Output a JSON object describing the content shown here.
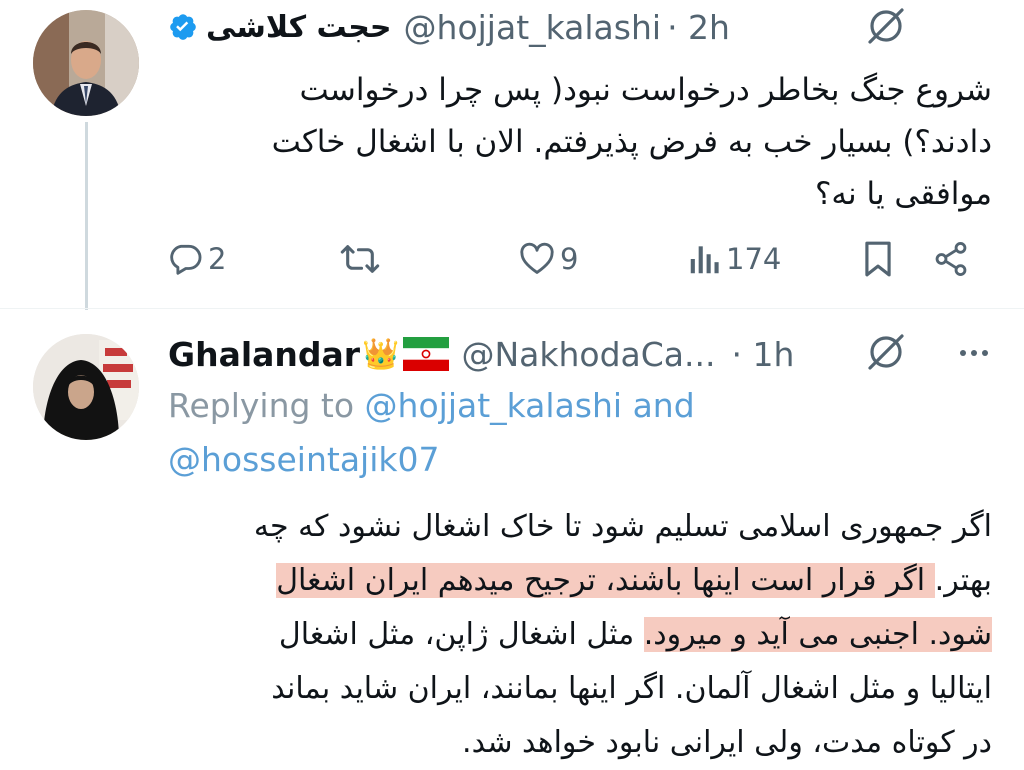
{
  "tweet1": {
    "display_name": "حجت کلاشی",
    "handle": "@hojjat_kalashi",
    "time": "· 2h",
    "lines": [
      "شروع جنگ بخاطر درخواست نبود( پس چرا درخواست",
      "دادند؟) بسیار خب به فرض پذیرفتم. الان با اشغال خاکت",
      "موافقی یا نه؟"
    ],
    "actions": {
      "replies": "2",
      "retweets": "",
      "likes": "9",
      "views": "174"
    }
  },
  "tweet2": {
    "display_name": "Ghalandar",
    "name_emoji": "👑",
    "handle": "@NakhodaCa...",
    "time": "· 1h",
    "replying_prefix": "Replying to",
    "reply_mention_1": "@hojjat_kalashi",
    "reply_and": "and",
    "reply_mention_2": "@hosseintajik07",
    "lines": [
      {
        "plain": "اگر جمهوری اسلامی تسلیم شود تا خاک اشغال نشود که چه",
        "hl": ""
      },
      {
        "plain": "بهتر.",
        "hl": " اگر قرار است اینها باشند، ترجیح میدهم ایران اشغال"
      },
      {
        "plain": " مثل اشغال ژاپن، مثل اشغال",
        "hl": "شود. اجنبی می آید و میرود."
      },
      {
        "plain": "ایتالیا و مثل اشغال آلمان. اگر اینها بمانند، ایران شاید بماند",
        "hl": ""
      },
      {
        "plain": "در کوتاه مدت، ولی ایرانی نابود خواهد شد.",
        "hl": ""
      }
    ]
  },
  "colors": {
    "verified": "#1d9bf0",
    "grey_text": "#536471",
    "mention": "#5b9fd6",
    "highlight": "#eea08c"
  }
}
